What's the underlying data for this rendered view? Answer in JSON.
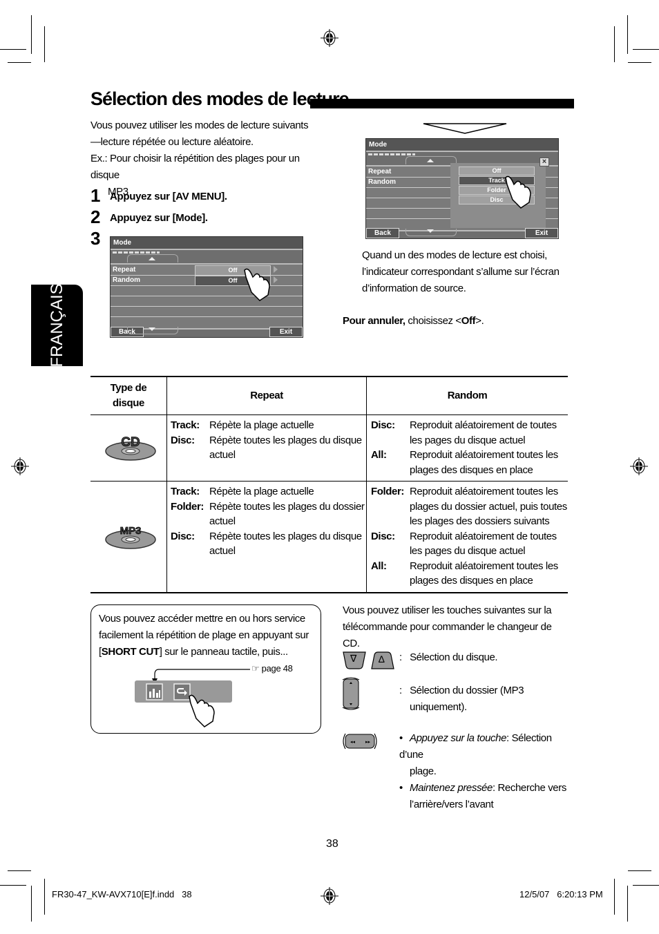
{
  "page": {
    "title": "Sélection des modes de lecture",
    "language_tab": "FRANÇAIS",
    "page_number": "38"
  },
  "intro": {
    "line1": "Vous pouvez utiliser les modes de lecture suivants",
    "line2": "—lecture répétée ou lecture aléatoire.",
    "example": "Ex.: Pour choisir la répétition des plages pour un disque",
    "example_cont": "MP3"
  },
  "steps": [
    {
      "num": "1",
      "text": "Appuyez sur [AV MENU]."
    },
    {
      "num": "2",
      "text": "Appuyez sur [Mode]."
    },
    {
      "num": "3",
      "text": ""
    }
  ],
  "screen1": {
    "header": "Mode",
    "rows": [
      "Repeat",
      "Random"
    ],
    "values": [
      "Off",
      "Off"
    ],
    "back": "Back",
    "exit": "Exit"
  },
  "screen2": {
    "header": "Mode",
    "rows": [
      "Repeat",
      "Random"
    ],
    "options": [
      "Off",
      "Track",
      "Folder",
      "Disc"
    ],
    "selected": "Track",
    "close_icon": "×",
    "back": "Back",
    "exit": "Exit"
  },
  "note": {
    "line1": "Quand un des modes de lecture est choisi,",
    "line2": "l’indicateur correspondant s’allume sur l’écran",
    "line3": "d’information de source.",
    "cancel_bold": "Pour annuler,",
    "cancel_text": " choisissez <",
    "cancel_off": "Off",
    "cancel_end": ">."
  },
  "table": {
    "headers": [
      "Type de disque",
      "Repeat",
      "Random"
    ],
    "rows": [
      {
        "disc": "CD",
        "repeat": [
          {
            "key": "Track:",
            "value": "Répète la plage actuelle"
          },
          {
            "key": "Disc:",
            "value": "Répète toutes les plages du disque actuel"
          }
        ],
        "random": [
          {
            "key": "Disc:",
            "value": "Reproduit aléatoirement de toutes les pages du disque actuel"
          },
          {
            "key": "All:",
            "value": "Reproduit aléatoirement toutes les plages des disques en place"
          }
        ]
      },
      {
        "disc": "MP3",
        "repeat": [
          {
            "key": "Track:",
            "value": "Répète la plage actuelle"
          },
          {
            "key": "Folder:",
            "value": "Répète toutes les plages du dossier actuel"
          },
          {
            "key": "Disc:",
            "value": "Répète toutes les plages du disque actuel"
          }
        ],
        "random": [
          {
            "key": "Folder:",
            "value": "Reproduit aléatoirement toutes les plages du dossier actuel, puis toutes les plages des dossiers suivants"
          },
          {
            "key": "Disc:",
            "value": "Reproduit aléatoirement de toutes les pages du disque actuel"
          },
          {
            "key": "All:",
            "value": "Reproduit aléatoirement toutes les plages des disques en place"
          }
        ]
      }
    ]
  },
  "tip": {
    "line1": "Vous pouvez accéder mettre en ou hors service",
    "line2": "facilement la répétition de plage en appuyant sur",
    "line3_open": "[",
    "line3_bold": "SHORT CUT",
    "line3_rest": "] sur le panneau tactile, puis...",
    "page_ref": "☞ page 48"
  },
  "remote": {
    "intro1": "Vous pouvez utiliser les touches suivantes sur la",
    "intro2": "télécommande pour commander le changeur de CD.",
    "disc_select": ":   Sélection du disque.",
    "folder_select1": ":   Sélection du dossier (MP3",
    "folder_select2": "uniquement).",
    "bullet1_italic": "Appuyez sur la touche",
    "bullet1_rest": ": Sélection d’une",
    "bullet1_cont": "plage.",
    "bullet2_italic": "Maintenez pressée",
    "bullet2_rest": ": Recherche vers",
    "bullet2_cont": "l’arrière/vers l’avant",
    "bullet": "•",
    "down_glyph": "∇",
    "up_glyph": "∆"
  },
  "footer": {
    "file": "FR30-47_KW-AVX710[E]f.indd   38",
    "timestamp": "12/5/07   6:20:13 PM"
  }
}
